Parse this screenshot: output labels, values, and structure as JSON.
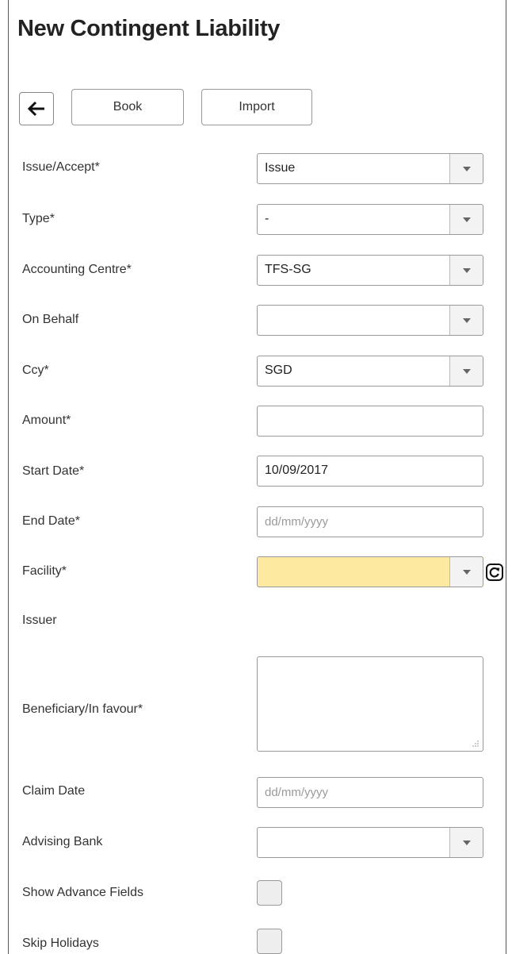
{
  "page": {
    "title": "New Contingent Liability"
  },
  "toolbar": {
    "book_label": "Book",
    "import_label": "Import"
  },
  "form": {
    "issue_accept": {
      "label": "Issue/Accept*",
      "value": "Issue"
    },
    "type": {
      "label": "Type*",
      "value": "-"
    },
    "accounting_centre": {
      "label": "Accounting Centre*",
      "value": "TFS-SG"
    },
    "on_behalf": {
      "label": "On Behalf",
      "value": ""
    },
    "ccy": {
      "label": "Ccy*",
      "value": "SGD"
    },
    "amount": {
      "label": "Amount*",
      "value": ""
    },
    "start_date": {
      "label": "Start Date*",
      "value": "10/09/2017"
    },
    "end_date": {
      "label": "End Date*",
      "placeholder": "dd/mm/yyyy"
    },
    "facility": {
      "label": "Facility*",
      "value": ""
    },
    "issuer": {
      "label": "Issuer"
    },
    "beneficiary": {
      "label": "Beneficiary/In favour*",
      "value": ""
    },
    "claim_date": {
      "label": "Claim Date",
      "placeholder": "dd/mm/yyyy"
    },
    "advising_bank": {
      "label": "Advising Bank",
      "value": ""
    },
    "show_advance_fields": {
      "label": "Show Advance Fields",
      "checked": false
    },
    "skip_holidays": {
      "label": "Skip Holidays",
      "checked": false
    }
  },
  "colors": {
    "facility_highlight": "#fde9a0",
    "border": "#999999",
    "text": "#333333"
  },
  "icons": {
    "back": "arrow-left-icon",
    "dropdown": "chevron-down-icon",
    "refresh": "refresh-icon",
    "resize": "resize-grip-icon"
  }
}
